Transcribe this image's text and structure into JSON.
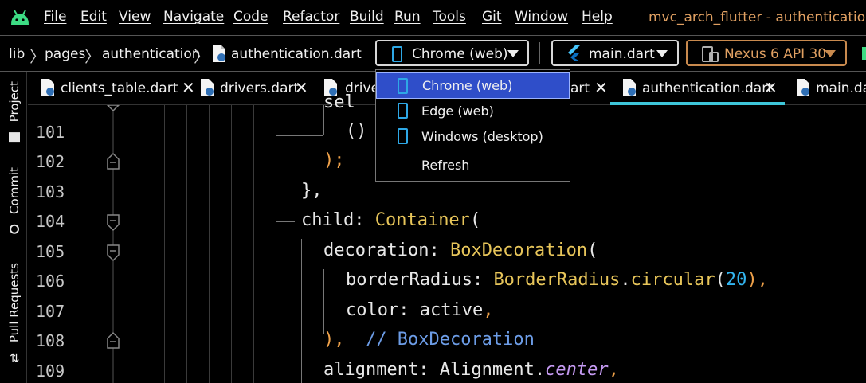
{
  "menu": {
    "items": [
      "File",
      "Edit",
      "View",
      "Navigate",
      "Code",
      "Refactor",
      "Build",
      "Run",
      "Tools",
      "Git",
      "Window",
      "Help"
    ],
    "window_title": "mvc_arch_flutter - authentication.da"
  },
  "nav": {
    "breadcrumbs": [
      "lib",
      "pages",
      "authentication",
      "authentication.dart"
    ],
    "device_selector": "Chrome (web)",
    "run_config": "main.dart",
    "emulator": "Nexus 6 API 30"
  },
  "sidebar": {
    "tabs": [
      "Project",
      "Commit",
      "Pull Requests"
    ]
  },
  "tabs": [
    {
      "label": "clients_table.dart",
      "close": "✕"
    },
    {
      "label": "drivers.dart",
      "close": "✕"
    },
    {
      "label": "drive",
      "close": ""
    },
    {
      "label": "art",
      "close": "✕"
    },
    {
      "label": "authentication.dart",
      "close": "✕",
      "active": true
    },
    {
      "label": "main.dar",
      "close": ""
    }
  ],
  "popup": {
    "items": [
      "Chrome (web)",
      "Edge (web)",
      "Windows (desktop)"
    ],
    "selected": "Chrome (web)",
    "refresh": "Refresh"
  },
  "editor": {
    "line_numbers": [
      "101",
      "102",
      "103",
      "104",
      "105",
      "106",
      "107",
      "108",
      "109"
    ],
    "lines": {
      "l100": "sel",
      "l101": "()",
      "l102": ");",
      "l103": "},",
      "l104_a": "child: ",
      "l104_b": "Container",
      "l104_c": "(",
      "l105_a": "decoration: ",
      "l105_b": "BoxDecoration",
      "l105_c": "(",
      "l106_a": "borderRadius: ",
      "l106_b": "BorderRadius",
      "l106_c": ".",
      "l106_d": "circular",
      "l106_e": "(",
      "l106_f": "20",
      "l106_g": "),",
      "l107_a": "color: active",
      "l107_b": ",",
      "l108_a": "),",
      "l108_b": "  // BoxDecoration",
      "l109_a": "alignment: Alignment.",
      "l109_b": "center",
      "l109_c": ","
    }
  },
  "colors": {
    "accent_tab_underline": "#3ec6d9",
    "popup_selected": "#2f4ec9",
    "window_title": "#e0a062"
  }
}
